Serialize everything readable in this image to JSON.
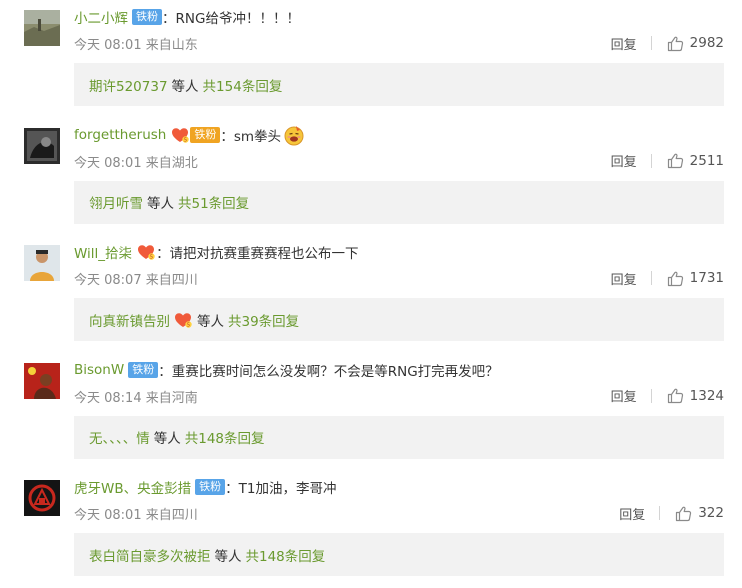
{
  "comments": [
    {
      "username": "小二小辉",
      "badge": "铁粉",
      "badge_style": "blue",
      "text": "：RNG给爷冲！！！！",
      "emoji": null,
      "time_location": "今天 08:01 来自山东",
      "reply_label": "回复",
      "likes": "2982",
      "reply_box": {
        "repliers": "期许520737",
        "fan_badge": false,
        "mid": "等人",
        "total": "共154条回复"
      }
    },
    {
      "username": "forgettherush",
      "badge": "铁粉",
      "badge_style": "gold",
      "text": "：sm拳头",
      "emoji": "doge-face-emoji",
      "time_location": "今天 08:01 来自湖北",
      "reply_label": "回复",
      "likes": "2511",
      "reply_box": {
        "repliers": "翎月听雪",
        "fan_badge": false,
        "mid": "等人",
        "total": "共51条回复"
      }
    },
    {
      "username": "Will_拾柒",
      "badge": null,
      "badge_style": "heart",
      "text": "：请把对抗赛重赛赛程也公布一下",
      "emoji": null,
      "time_location": "今天 08:07 来自四川",
      "reply_label": "回复",
      "likes": "1731",
      "reply_box": {
        "repliers": "向真新镇告别",
        "fan_badge": true,
        "mid": "等人",
        "total": "共39条回复"
      }
    },
    {
      "username": "BisonW",
      "badge": "铁粉",
      "badge_style": "blue",
      "text": "：重赛比赛时间怎么没发啊？不会是等RNG打完再发吧？",
      "emoji": null,
      "time_location": "今天 08:14 来自河南",
      "reply_label": "回复",
      "likes": "1324",
      "reply_box": {
        "repliers": "无、、、、情",
        "fan_badge": false,
        "mid": "等人",
        "total": "共148条回复"
      }
    },
    {
      "username": "虎牙WB、央金彭措",
      "badge": "铁粉",
      "badge_style": "blue",
      "text": "：T1加油，李哥冲",
      "emoji": null,
      "time_location": "今天 08:01 来自四川",
      "reply_label": "回复",
      "likes": "322",
      "reply_box": {
        "repliers": "表白简自豪多次被拒",
        "fan_badge": false,
        "mid": "等人",
        "total": "共148条回复"
      }
    }
  ],
  "colors": {
    "username": "#6a9a2f",
    "meta": "#8a8a8a",
    "badge_blue": "#58a4e8",
    "badge_gold": "#f0a422",
    "reply_box_bg": "#f2f2f2"
  }
}
